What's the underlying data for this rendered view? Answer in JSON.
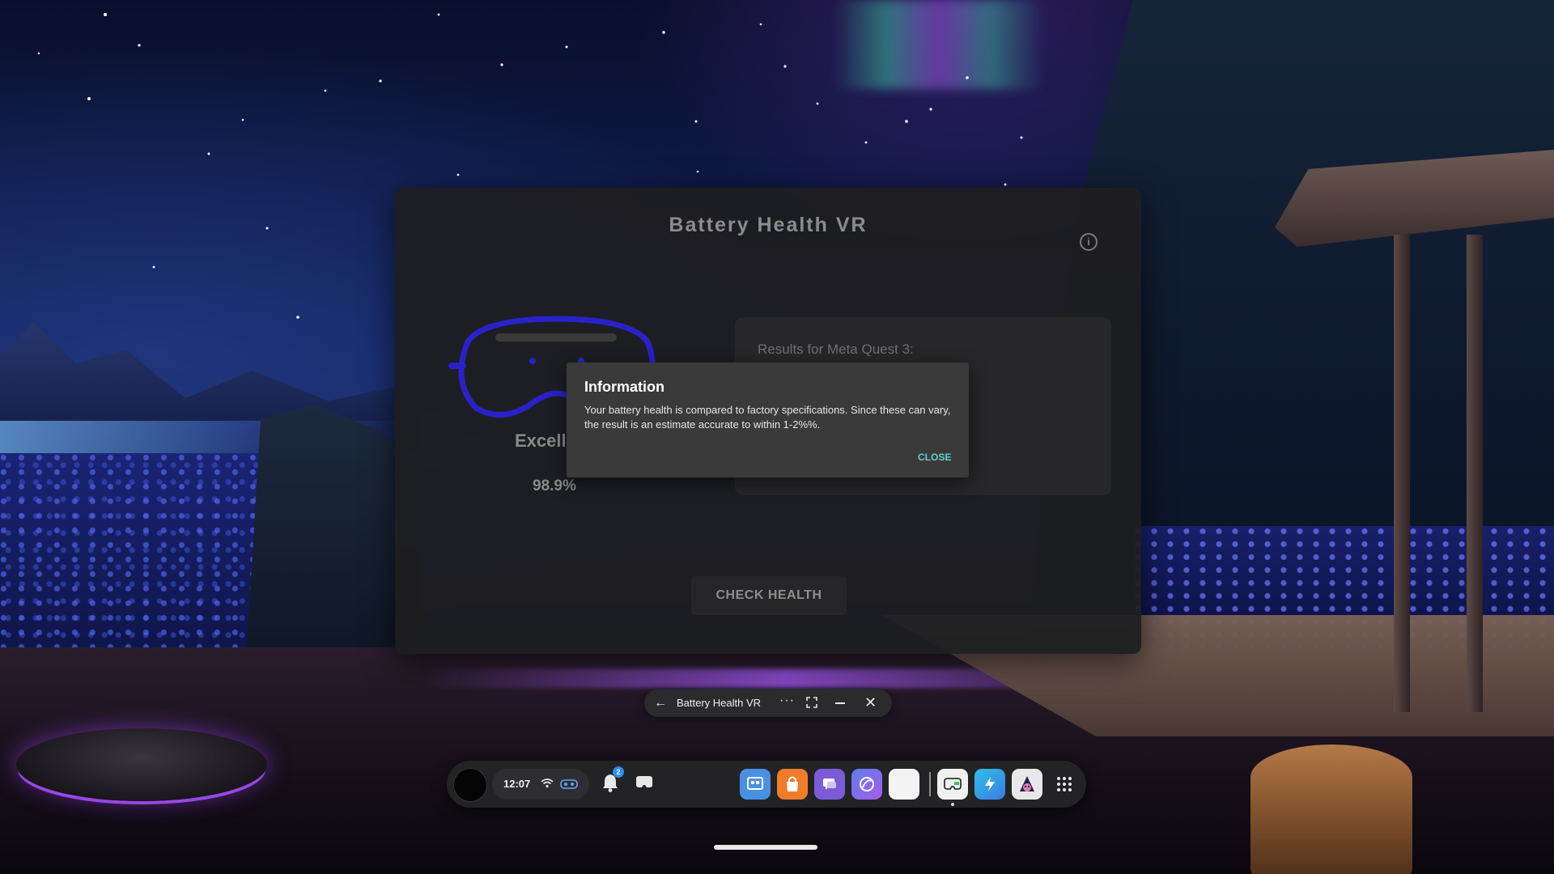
{
  "app": {
    "title": "Battery Health VR",
    "status_label": "Excell",
    "health_percent": "98.9%",
    "results_label": "Results for Meta Quest 3:",
    "check_button_label": "CHECK HEALTH",
    "info_icon": "info-icon"
  },
  "dialog": {
    "title": "Information",
    "body": "Your battery health is compared to factory specifications. Since these can vary, the result is an estimate accurate to within 1-2%%.",
    "close_label": "CLOSE"
  },
  "window_bar": {
    "title": "Battery Health VR",
    "icons": [
      "back-arrow-icon",
      "more-icon",
      "expand-icon",
      "minimize-icon",
      "close-icon"
    ]
  },
  "taskbar": {
    "time": "12:07",
    "notification_count": "2",
    "apps": [
      {
        "name": "meta-app-icon",
        "color": "#4a90e2"
      },
      {
        "name": "store-app-icon",
        "color": "#f07c2a"
      },
      {
        "name": "messenger-app-icon",
        "color": "#7b5bd6"
      },
      {
        "name": "horizon-app-icon",
        "color": "#6a6ad8"
      },
      {
        "name": "browser-app-icon",
        "color": "#f4f4f4"
      },
      {
        "name": "battery-health-app-icon",
        "color": "#f0f0f0"
      },
      {
        "name": "blue-app-icon",
        "color": "#33a7e8"
      },
      {
        "name": "game-app-icon",
        "color": "#e8e8e8"
      }
    ]
  },
  "colors": {
    "accent_teal": "#5fd3c4",
    "headset_outline": "#2a22c8",
    "floor_glow": "#aa5aff"
  }
}
